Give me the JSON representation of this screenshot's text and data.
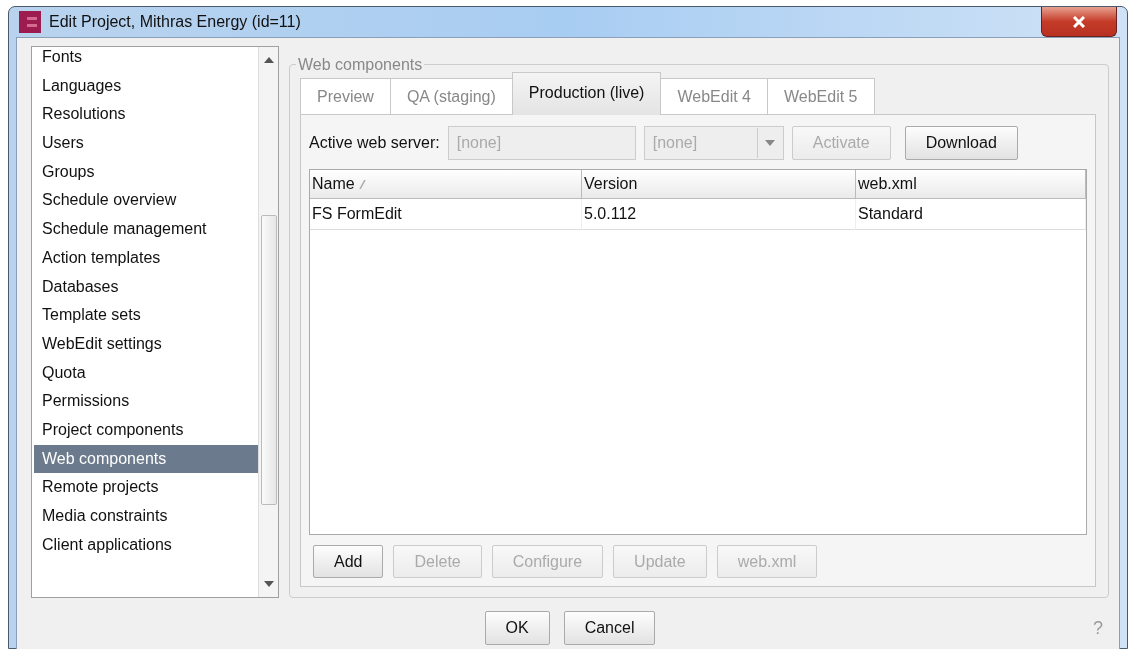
{
  "window": {
    "title": "Edit Project, Mithras Energy (id=11)"
  },
  "sidebar": {
    "items": [
      {
        "label": "Fonts",
        "selected": false
      },
      {
        "label": "Languages",
        "selected": false
      },
      {
        "label": "Resolutions",
        "selected": false
      },
      {
        "label": "Users",
        "selected": false
      },
      {
        "label": "Groups",
        "selected": false
      },
      {
        "label": "Schedule overview",
        "selected": false
      },
      {
        "label": "Schedule management",
        "selected": false
      },
      {
        "label": "Action templates",
        "selected": false
      },
      {
        "label": "Databases",
        "selected": false
      },
      {
        "label": "Template sets",
        "selected": false
      },
      {
        "label": "WebEdit settings",
        "selected": false
      },
      {
        "label": "Quota",
        "selected": false
      },
      {
        "label": "Permissions",
        "selected": false
      },
      {
        "label": "Project components",
        "selected": false
      },
      {
        "label": "Web components",
        "selected": true
      },
      {
        "label": "Remote projects",
        "selected": false
      },
      {
        "label": "Media constraints",
        "selected": false
      },
      {
        "label": "Client applications",
        "selected": false
      }
    ]
  },
  "group": {
    "title": "Web components"
  },
  "tabs": [
    {
      "label": "Preview",
      "selected": false
    },
    {
      "label": "QA (staging)",
      "selected": false
    },
    {
      "label": "Production (live)",
      "selected": true
    },
    {
      "label": "WebEdit 4",
      "selected": false
    },
    {
      "label": "WebEdit 5",
      "selected": false
    }
  ],
  "server": {
    "label": "Active web server:",
    "field_value": "[none]",
    "select_value": "[none]",
    "disabled": true,
    "buttons": [
      {
        "label": "Activate",
        "disabled": true
      },
      {
        "label": "Download",
        "disabled": false
      }
    ]
  },
  "table": {
    "columns": [
      "Name",
      "Version",
      "web.xml"
    ],
    "rows": [
      [
        "FS FormEdit",
        "5.0.112",
        "Standard"
      ]
    ]
  },
  "table_buttons": [
    {
      "label": "Add",
      "disabled": false
    },
    {
      "label": "Delete",
      "disabled": true
    },
    {
      "label": "Configure",
      "disabled": true
    },
    {
      "label": "Update",
      "disabled": true
    },
    {
      "label": "web.xml",
      "disabled": true
    }
  ],
  "dialog_buttons": [
    {
      "label": "OK",
      "disabled": false
    },
    {
      "label": "Cancel",
      "disabled": false
    }
  ],
  "help": "?"
}
